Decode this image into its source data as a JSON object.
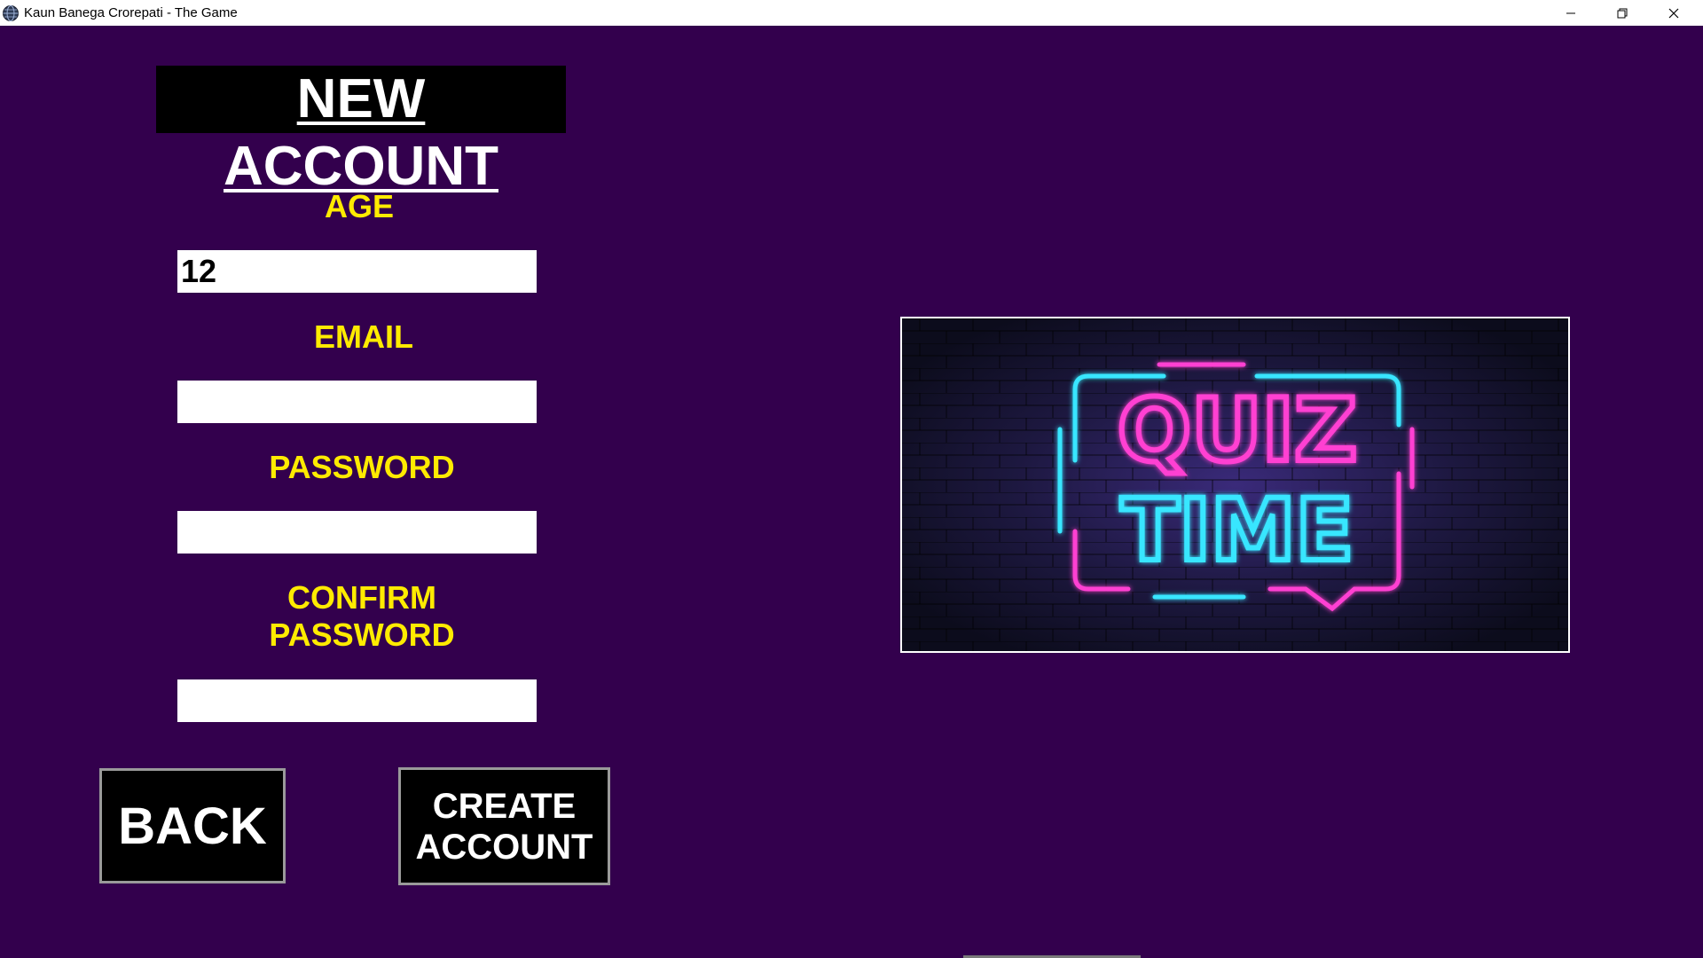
{
  "window": {
    "title": "Kaun Banega Crorepati - The Game",
    "icon": "app-globe-icon",
    "controls": [
      "minimize-icon",
      "restore-icon",
      "close-icon"
    ]
  },
  "form": {
    "heading": "NEW ACCOUNT",
    "age_label": "AGE",
    "age_value": "12",
    "email_label": "EMAIL",
    "email_value": "",
    "password_label": "PASSWORD",
    "password_value": "",
    "confirm_label_line1": "CONFIRM",
    "confirm_label_line2": "PASSWORD",
    "confirm_value": ""
  },
  "buttons": {
    "back": "BACK",
    "create_line1": "CREATE",
    "create_line2": "ACCOUNT"
  },
  "banner": {
    "line1": "QUIZ",
    "line2": "TIME"
  },
  "colors": {
    "background": "#33004d",
    "label": "#ffeb00",
    "neon_pink": "#ff3fd2",
    "neon_cyan": "#39e6ff"
  }
}
